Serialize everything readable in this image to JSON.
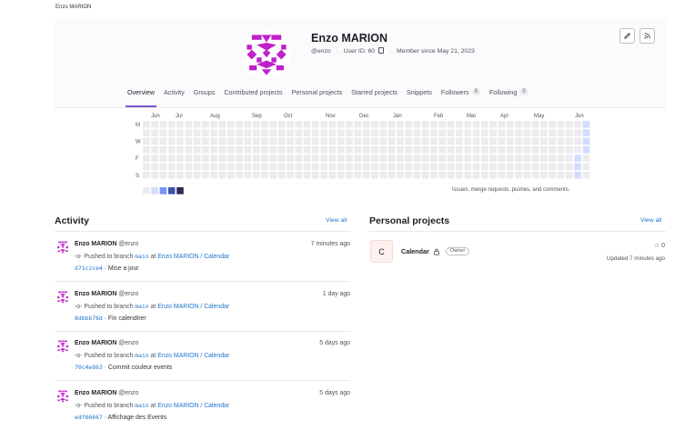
{
  "breadcrumb": "Enzo MARION",
  "profile": {
    "name": "Enzo MARION",
    "username": "@enzo",
    "user_id": "User ID: 60",
    "member_since": "Member since May 21, 2023"
  },
  "tabs": [
    {
      "label": "Overview",
      "active": true,
      "count": ""
    },
    {
      "label": "Activity",
      "active": false,
      "count": ""
    },
    {
      "label": "Groups",
      "active": false,
      "count": ""
    },
    {
      "label": "Contributed projects",
      "active": false,
      "count": ""
    },
    {
      "label": "Personal projects",
      "active": false,
      "count": ""
    },
    {
      "label": "Starred projects",
      "active": false,
      "count": ""
    },
    {
      "label": "Snippets",
      "active": false,
      "count": ""
    },
    {
      "label": "Followers",
      "active": false,
      "count": "0"
    },
    {
      "label": "Following",
      "active": false,
      "count": "0"
    }
  ],
  "calendar": {
    "months": [
      "Jun",
      "Jul",
      "Aug",
      "Sep",
      "Oct",
      "Nov",
      "Dec",
      "Jan",
      "Feb",
      "Mar",
      "Apr",
      "May",
      "Jun"
    ],
    "day_labels": [
      "M",
      "W",
      "F",
      "S"
    ],
    "note": "Issues, merge requests, pushes, and comments.",
    "legend_colors": [
      "#ececef",
      "#d2dcff",
      "#7992f5",
      "#3f51ae",
      "#2a2b59"
    ],
    "active_cells": [
      {
        "week": 52,
        "day": 0,
        "level": 1
      },
      {
        "week": 52,
        "day": 1,
        "level": 1
      },
      {
        "week": 52,
        "day": 2,
        "level": 1
      },
      {
        "week": 52,
        "day": 3,
        "level": 1
      },
      {
        "week": 51,
        "day": 4,
        "level": 1
      },
      {
        "week": 51,
        "day": 5,
        "level": 1
      },
      {
        "week": 51,
        "day": 6,
        "level": 1
      }
    ]
  },
  "activity": {
    "title": "Activity",
    "view_all": "View all",
    "items": [
      {
        "name": "Enzo MARION",
        "handle": "@enzo",
        "time": "7 minutes ago",
        "action": "Pushed to branch",
        "branch": "main",
        "at": "at",
        "project": "Enzo MARION / Calendar",
        "sha": "d71c2ce4",
        "message": "Mise a jour"
      },
      {
        "name": "Enzo MARION",
        "handle": "@enzo",
        "time": "1 day ago",
        "action": "Pushed to branch",
        "branch": "main",
        "at": "at",
        "project": "Enzo MARION / Calendar",
        "sha": "8dbbb76d",
        "message": "Fin calendrier"
      },
      {
        "name": "Enzo MARION",
        "handle": "@enzo",
        "time": "5 days ago",
        "action": "Pushed to branch",
        "branch": "main",
        "at": "at",
        "project": "Enzo MARION / Calendar",
        "sha": "70c4e863",
        "message": "Commit couleur events"
      },
      {
        "name": "Enzo MARION",
        "handle": "@enzo",
        "time": "5 days ago",
        "action": "Pushed to branch",
        "branch": "main",
        "at": "at",
        "project": "Enzo MARION / Calendar",
        "sha": "edf66667",
        "message": "Affichage des Events"
      }
    ]
  },
  "personal_projects": {
    "title": "Personal projects",
    "view_all": "View all",
    "items": [
      {
        "initial": "C",
        "name": "Calendar",
        "role": "Owner",
        "stars": "0",
        "updated": "Updated 7 minutes ago"
      }
    ]
  },
  "colors": {
    "accent": "#7b58cf",
    "link": "#1f75cb",
    "avatar": "#c11fc9"
  }
}
